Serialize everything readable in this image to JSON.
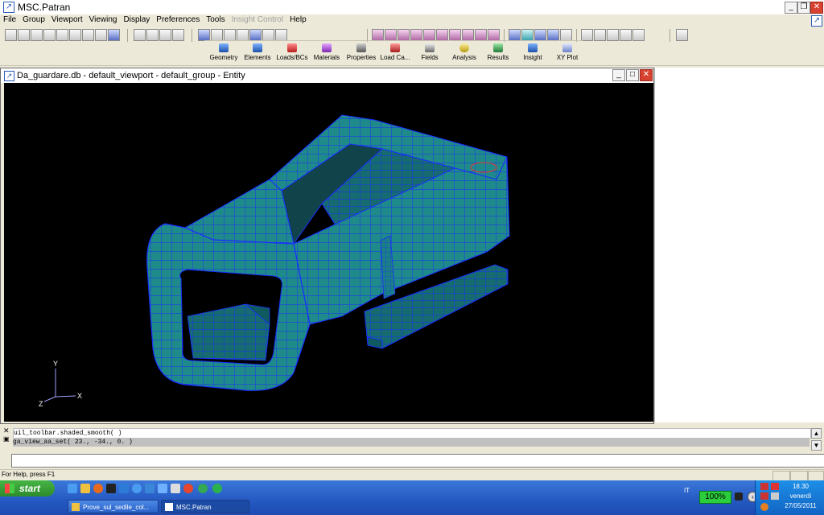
{
  "app": {
    "title": "MSC.Patran",
    "icon": "patran-icon"
  },
  "menu": [
    "File",
    "Group",
    "Viewport",
    "Viewing",
    "Display",
    "Preferences",
    "Tools",
    "Insight Control",
    "Help"
  ],
  "menu_disabled": [
    "Insight Control"
  ],
  "app_buttons": [
    "Geometry",
    "Elements",
    "Loads/BCs",
    "Materials",
    "Properties",
    "Load Ca...",
    "Fields",
    "Analysis",
    "Results",
    "Insight",
    "XY Plot"
  ],
  "viewport": {
    "title": "Da_guardare.db - default_viewport - default_group - Entity",
    "axes": {
      "y": "Y",
      "z": "Z",
      "x": "X"
    }
  },
  "history": [
    "uil_toolbar.shaded_smooth( )",
    "ga_view_aa_set( 23., -34., 0. )"
  ],
  "command_input": "",
  "status": "For Help, press F1",
  "taskbar": {
    "start": "start",
    "tasks": [
      "Prove_sul_sedile_col...",
      "MSC.Patran"
    ],
    "language": "IT",
    "battery": "100%",
    "time": "18.30",
    "day": "venerdì",
    "date": "27/05/2011"
  },
  "colors": {
    "viewport_bg": "#000000",
    "mesh_fill": "#1f8a8a",
    "mesh_line": "#1a2cff",
    "taskbar": "#2458c2",
    "start": "#2e8a2b"
  }
}
